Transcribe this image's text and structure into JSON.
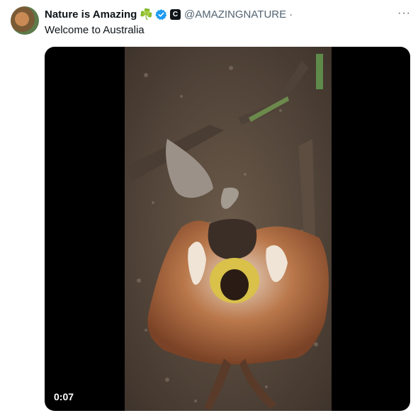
{
  "tweet": {
    "author_name": "Nature is Amazing",
    "name_emoji": "☘️",
    "handle": "@AMAZINGNATURE",
    "separator": "·",
    "affiliate_badge": "C",
    "text": "Welcome to Australia",
    "more_label": "···"
  },
  "video": {
    "duration": "0:07"
  },
  "colors": {
    "verified": "#1d9bf0",
    "secondary_text": "#536471"
  }
}
